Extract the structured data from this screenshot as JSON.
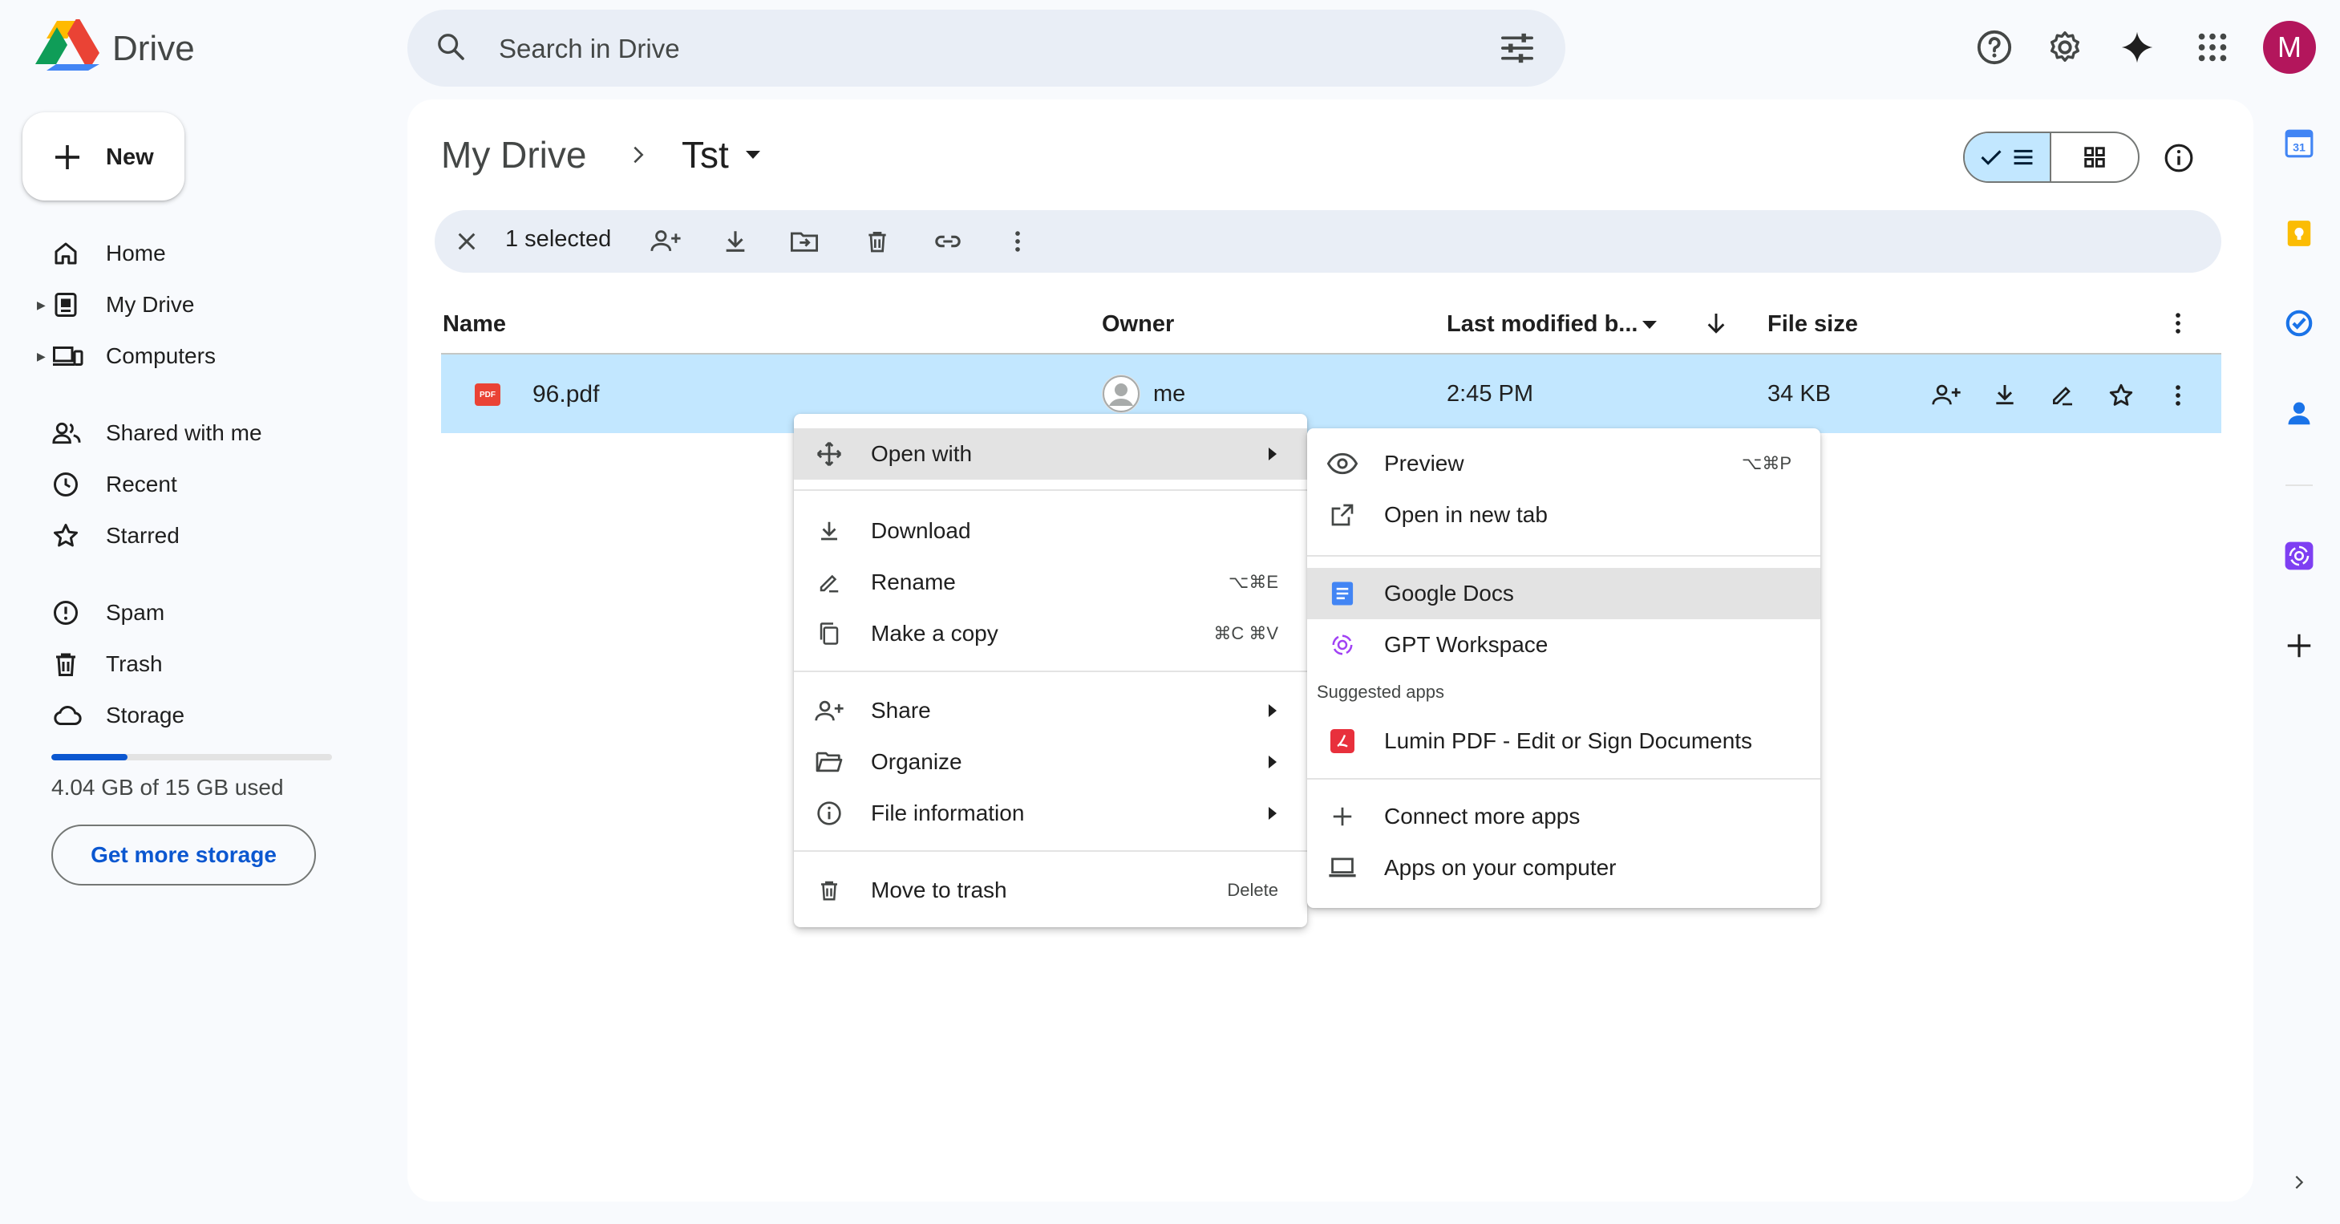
{
  "header": {
    "app_name": "Drive",
    "search_placeholder": "Search in Drive",
    "avatar_letter": "M"
  },
  "sidebar": {
    "new_label": "New",
    "items": [
      {
        "label": "Home",
        "icon": "home-icon"
      },
      {
        "label": "My Drive",
        "icon": "my-drive-icon"
      },
      {
        "label": "Computers",
        "icon": "computers-icon"
      },
      {
        "label": "Shared with me",
        "icon": "shared-icon"
      },
      {
        "label": "Recent",
        "icon": "clock-icon"
      },
      {
        "label": "Starred",
        "icon": "star-icon"
      },
      {
        "label": "Spam",
        "icon": "spam-icon"
      },
      {
        "label": "Trash",
        "icon": "trash-icon"
      },
      {
        "label": "Storage",
        "icon": "cloud-icon"
      }
    ],
    "storage_used_fraction": 0.27,
    "storage_text": "4.04 GB of 15 GB used",
    "get_storage_label": "Get more storage"
  },
  "main": {
    "breadcrumb": [
      "My Drive",
      "Tst"
    ],
    "selection_text": "1 selected",
    "columns": {
      "name": "Name",
      "owner": "Owner",
      "modified": "Last modified b...",
      "size": "File size"
    },
    "file": {
      "name": "96.pdf",
      "type_badge": "PDF",
      "owner": "me",
      "modified": "2:45 PM",
      "size": "34 KB"
    }
  },
  "context_menu": {
    "open_with": "Open with",
    "download": "Download",
    "rename": "Rename",
    "rename_shortcut": "⌥⌘E",
    "make_copy": "Make a copy",
    "make_copy_shortcut": "⌘C ⌘V",
    "share": "Share",
    "organize": "Organize",
    "file_info": "File information",
    "move_trash": "Move to trash",
    "move_trash_shortcut": "Delete"
  },
  "open_with_menu": {
    "preview": "Preview",
    "preview_shortcut": "⌥⌘P",
    "new_tab": "Open in new tab",
    "google_docs": "Google Docs",
    "gpt_workspace": "GPT Workspace",
    "suggested_label": "Suggested apps",
    "lumin": "Lumin PDF - Edit or Sign Documents",
    "connect": "Connect more apps",
    "computer_apps": "Apps on your computer"
  },
  "side_panel": {
    "calendar_day": "31"
  },
  "colors": {
    "accent": "#0b57d0",
    "selected_row": "#c2e7ff",
    "avatar": "#b3165c",
    "pdf_red": "#ea4335"
  }
}
